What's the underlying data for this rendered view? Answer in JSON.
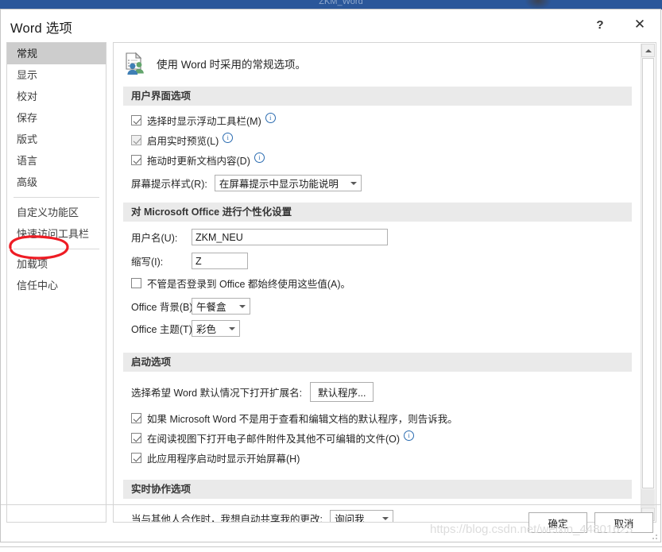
{
  "app_strip": {
    "title": "ZKM_Word"
  },
  "dialog": {
    "title": "Word 选项",
    "help_label": "?",
    "close_label": "✕"
  },
  "nav": {
    "items": [
      {
        "label": "常规",
        "selected": true
      },
      {
        "label": "显示",
        "selected": false
      },
      {
        "label": "校对",
        "selected": false
      },
      {
        "label": "保存",
        "selected": false
      },
      {
        "label": "版式",
        "selected": false
      },
      {
        "label": "语言",
        "selected": false
      },
      {
        "label": "高级",
        "selected": false
      },
      {
        "label": "自定义功能区",
        "selected": false
      },
      {
        "label": "快速访问工具栏",
        "selected": false
      },
      {
        "label": "加载项",
        "selected": false
      },
      {
        "label": "信任中心",
        "selected": false
      }
    ]
  },
  "annotation": {
    "color": "#ee1c24",
    "target": "加载项"
  },
  "content": {
    "intro": "使用 Word 时采用的常规选项。",
    "groups": {
      "ui_options": {
        "header": "用户界面选项",
        "cb_floating_toolbar": "选择时显示浮动工具栏(M)",
        "cb_live_preview": "启用实时预览(L)",
        "cb_update_drag": "拖动时更新文档内容(D)",
        "screentip_label": "屏幕提示样式(R):",
        "screentip_value": "在屏幕提示中显示功能说明"
      },
      "personalize": {
        "header": "对 Microsoft Office 进行个性化设置",
        "username_label": "用户名(U):",
        "username_value": "ZKM_NEU",
        "initials_label": "缩写(I):",
        "initials_value": "Z",
        "cb_always_use": "不管是否登录到 Office 都始终使用这些值(A)。",
        "background_label": "Office 背景(B):",
        "background_value": "午餐盒",
        "theme_label": "Office 主题(T):",
        "theme_value": "彩色"
      },
      "startup": {
        "header": "启动选项",
        "default_ext_label": "选择希望 Word 默认情况下打开扩展名:",
        "default_program_button": "默认程序...",
        "cb_tell_me_default": "如果 Microsoft Word 不是用于查看和编辑文档的默认程序，则告诉我。",
        "cb_reading_view": "在阅读视图下打开电子邮件附件及其他不可编辑的文件(O)",
        "cb_start_screen": "此应用程序启动时显示开始屏幕(H)"
      },
      "realtime": {
        "header": "实时协作选项",
        "share_label": "当与其他人合作时，我想自动共享我的更改:",
        "share_value": "询问我"
      }
    }
  },
  "footer": {
    "ok_label": "确定",
    "cancel_label": "取消"
  },
  "watermark": "https://blog.csdn.net/weixin_44801623"
}
